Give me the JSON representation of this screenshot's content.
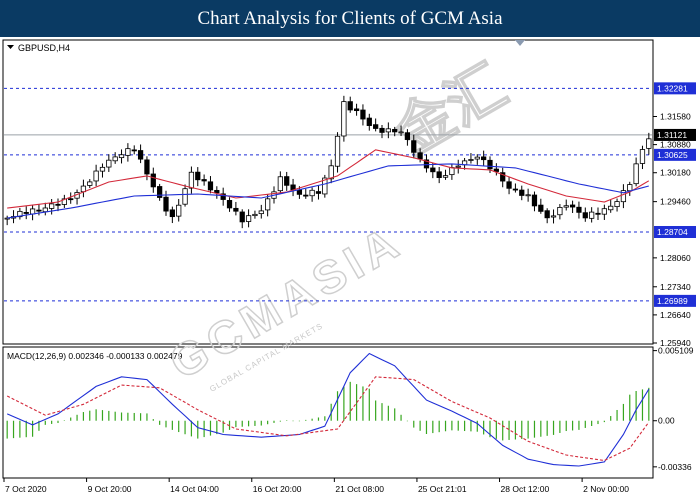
{
  "banner": {
    "title": "Chart Analysis for Clients of GCM Asia"
  },
  "watermark": {
    "text": "GCMASIA",
    "cjk": "金汇",
    "tagline": "GLOBAL CAPITAL MARKETS"
  },
  "colors": {
    "background": "#ffffff",
    "banner": "#0a3a63",
    "bull_candle": "#ffffff",
    "bear_candle": "#000000",
    "ma_fast": "#d3293a",
    "ma_slow": "#1f2fd6",
    "level_line": "#1f2fd6",
    "macd_line": "#1f2fd6",
    "signal_line": "#d3293a",
    "histogram": "#37a61f"
  },
  "chart_data": [
    {
      "type": "candlestick",
      "symbol_label": "GBPUSD,H4",
      "ylim": [
        1.2594,
        1.3346
      ],
      "y_ticks": [
        "1.31580",
        "1.30880",
        "1.30180",
        "1.29460",
        "1.28060",
        "1.27340",
        "1.26640",
        "1.25940"
      ],
      "y_tick_values": [
        1.3158,
        1.3088,
        1.3018,
        1.2946,
        1.2806,
        1.2734,
        1.2664,
        1.2594
      ],
      "x_ticks": [
        "7 Oct 2020",
        "9 Oct 20:00",
        "14 Oct 04:00",
        "16 Oct 20:00",
        "21 Oct 08:00",
        "25 Oct 21:01",
        "28 Oct 12:00",
        "2 Nov 00:00"
      ],
      "x_tick_index": [
        0,
        13,
        26,
        39,
        52,
        65,
        78,
        91
      ],
      "n_bars": 102,
      "current_price": "1.31121",
      "current_price_value": 1.31121,
      "levels": [
        {
          "label": "1.32281",
          "value": 1.32281
        },
        {
          "label": "1.30625",
          "value": 1.30625
        },
        {
          "label": "1.28704",
          "value": 1.28704
        },
        {
          "label": "1.26989",
          "value": 1.26989
        }
      ],
      "close_path": [
        [
          0,
          1.2905
        ],
        [
          5,
          1.2915
        ],
        [
          10,
          1.2965
        ],
        [
          15,
          1.3035
        ],
        [
          18,
          1.3055
        ],
        [
          20,
          1.307
        ],
        [
          24,
          1.296
        ],
        [
          26,
          1.2915
        ],
        [
          29,
          1.302
        ],
        [
          32,
          1.297
        ],
        [
          35,
          1.2925
        ],
        [
          37,
          1.29
        ],
        [
          40,
          1.2935
        ],
        [
          43,
          1.301
        ],
        [
          46,
          1.2955
        ],
        [
          49,
          1.296
        ],
        [
          51,
          1.303
        ],
        [
          53,
          1.3195
        ],
        [
          55,
          1.318
        ],
        [
          58,
          1.313
        ],
        [
          62,
          1.311
        ],
        [
          65,
          1.304
        ],
        [
          68,
          1.301
        ],
        [
          71,
          1.305
        ],
        [
          74,
          1.306
        ],
        [
          76,
          1.3025
        ],
        [
          79,
          1.297
        ],
        [
          82,
          1.296
        ],
        [
          85,
          1.2915
        ],
        [
          88,
          1.2945
        ],
        [
          91,
          1.29
        ],
        [
          94,
          1.2915
        ],
        [
          96,
          1.2945
        ],
        [
          98,
          1.3
        ],
        [
          100,
          1.309
        ],
        [
          101,
          1.3112
        ]
      ],
      "ma_fast_path": [
        [
          0,
          1.293
        ],
        [
          8,
          1.2945
        ],
        [
          16,
          1.2995
        ],
        [
          22,
          1.301
        ],
        [
          28,
          1.2985
        ],
        [
          36,
          1.2955
        ],
        [
          44,
          1.297
        ],
        [
          52,
          1.301
        ],
        [
          58,
          1.3075
        ],
        [
          64,
          1.3055
        ],
        [
          70,
          1.303
        ],
        [
          76,
          1.3025
        ],
        [
          82,
          1.299
        ],
        [
          88,
          1.296
        ],
        [
          94,
          1.2945
        ],
        [
          98,
          1.297
        ],
        [
          101,
          1.2998
        ]
      ],
      "ma_slow_path": [
        [
          0,
          1.2905
        ],
        [
          10,
          1.293
        ],
        [
          20,
          1.296
        ],
        [
          30,
          1.2965
        ],
        [
          40,
          1.2955
        ],
        [
          50,
          1.299
        ],
        [
          60,
          1.3035
        ],
        [
          70,
          1.304
        ],
        [
          80,
          1.303
        ],
        [
          90,
          1.299
        ],
        [
          97,
          1.2968
        ],
        [
          101,
          1.2985
        ]
      ]
    },
    {
      "type": "macd",
      "label": "MACD(12,26,9) 0.002346 -0.000133 0.002479",
      "ylim": [
        -0.0041,
        0.0053
      ],
      "y_ticks": [
        "0.005109",
        "0.00",
        "-0.00336"
      ],
      "y_tick_values": [
        0.005109,
        0.0,
        -0.00336
      ],
      "macd_path": [
        [
          0,
          0.0005
        ],
        [
          4,
          -0.0003
        ],
        [
          8,
          0.0005
        ],
        [
          14,
          0.0025
        ],
        [
          18,
          0.0032
        ],
        [
          22,
          0.003
        ],
        [
          26,
          0.0012
        ],
        [
          30,
          -0.0005
        ],
        [
          34,
          -0.001
        ],
        [
          40,
          -0.0012
        ],
        [
          46,
          -0.001
        ],
        [
          50,
          -0.0004
        ],
        [
          54,
          0.0035
        ],
        [
          57,
          0.0049
        ],
        [
          61,
          0.004
        ],
        [
          66,
          0.0015
        ],
        [
          70,
          0.0007
        ],
        [
          74,
          -0.0002
        ],
        [
          78,
          -0.0018
        ],
        [
          82,
          -0.0028
        ],
        [
          86,
          -0.0032
        ],
        [
          90,
          -0.0033
        ],
        [
          94,
          -0.003
        ],
        [
          97,
          -0.001
        ],
        [
          99,
          0.0008
        ],
        [
          101,
          0.0023
        ]
      ],
      "signal_path": [
        [
          0,
          0.0018
        ],
        [
          6,
          0.0004
        ],
        [
          12,
          0.0012
        ],
        [
          18,
          0.0026
        ],
        [
          24,
          0.0024
        ],
        [
          30,
          0.0008
        ],
        [
          36,
          -0.0006
        ],
        [
          44,
          -0.0011
        ],
        [
          52,
          -0.0006
        ],
        [
          58,
          0.0032
        ],
        [
          64,
          0.003
        ],
        [
          70,
          0.0014
        ],
        [
          76,
          0.0002
        ],
        [
          82,
          -0.0015
        ],
        [
          88,
          -0.0025
        ],
        [
          94,
          -0.0029
        ],
        [
          98,
          -0.002
        ],
        [
          101,
          -0.0001
        ]
      ]
    }
  ]
}
